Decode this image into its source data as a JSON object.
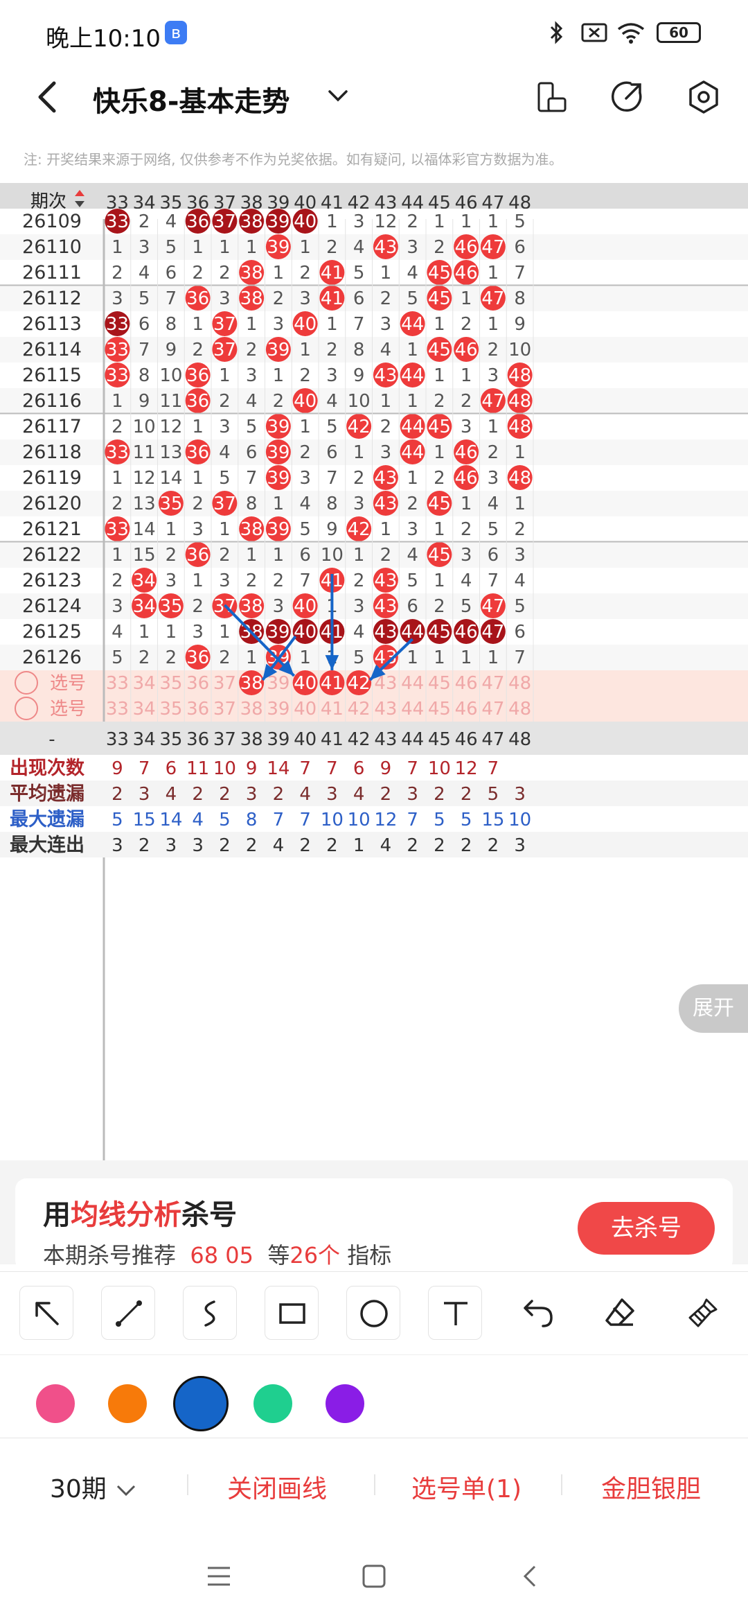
{
  "status_bar": {
    "time": "晚上10:10",
    "battery": "60"
  },
  "header": {
    "title": "快乐8-基本走势"
  },
  "note": "注: 开奖结果来源于网络, 仅供参考不作为兑奖依据。如有疑问, 以福体彩官方数据为准。",
  "table": {
    "period_header": "期次",
    "columns": [
      "33",
      "34",
      "35",
      "36",
      "37",
      "38",
      "39",
      "40",
      "41",
      "42",
      "43",
      "44",
      "45",
      "46",
      "47",
      "48"
    ],
    "rows": [
      {
        "period": "26109",
        "cells": [
          "33",
          "2",
          "4",
          "36",
          "37",
          "38",
          "39",
          "40",
          "1",
          "3",
          "12",
          "2",
          "1",
          "1",
          "1",
          "5"
        ]
      },
      {
        "period": "26110",
        "cells": [
          "1",
          "3",
          "5",
          "1",
          "1",
          "1",
          "39",
          "1",
          "2",
          "4",
          "43",
          "3",
          "2",
          "46",
          "47",
          "6"
        ]
      },
      {
        "period": "26111",
        "cells": [
          "2",
          "4",
          "6",
          "2",
          "2",
          "38",
          "1",
          "2",
          "41",
          "5",
          "1",
          "4",
          "45",
          "46",
          "1",
          "7"
        ]
      },
      {
        "period": "26112",
        "cells": [
          "3",
          "5",
          "7",
          "36",
          "3",
          "38",
          "2",
          "3",
          "41",
          "6",
          "2",
          "5",
          "45",
          "1",
          "47",
          "8"
        ]
      },
      {
        "period": "26113",
        "cells": [
          "33",
          "6",
          "8",
          "1",
          "37",
          "1",
          "3",
          "40",
          "1",
          "7",
          "3",
          "44",
          "1",
          "2",
          "1",
          "9"
        ]
      },
      {
        "period": "26114",
        "cells": [
          "33",
          "7",
          "9",
          "2",
          "37",
          "2",
          "39",
          "1",
          "2",
          "8",
          "4",
          "1",
          "45",
          "46",
          "2",
          "10"
        ]
      },
      {
        "period": "26115",
        "cells": [
          "33",
          "8",
          "10",
          "36",
          "1",
          "3",
          "1",
          "2",
          "3",
          "9",
          "43",
          "44",
          "1",
          "1",
          "3",
          "48"
        ]
      },
      {
        "period": "26116",
        "cells": [
          "1",
          "9",
          "11",
          "36",
          "2",
          "4",
          "2",
          "40",
          "4",
          "10",
          "1",
          "1",
          "2",
          "2",
          "47",
          "48"
        ]
      },
      {
        "period": "26117",
        "cells": [
          "2",
          "10",
          "12",
          "1",
          "3",
          "5",
          "39",
          "1",
          "5",
          "42",
          "2",
          "44",
          "45",
          "3",
          "1",
          "48"
        ]
      },
      {
        "period": "26118",
        "cells": [
          "33",
          "11",
          "13",
          "36",
          "4",
          "6",
          "39",
          "2",
          "6",
          "1",
          "3",
          "44",
          "1",
          "46",
          "2",
          "1"
        ]
      },
      {
        "period": "26119",
        "cells": [
          "1",
          "12",
          "14",
          "1",
          "5",
          "7",
          "39",
          "3",
          "7",
          "2",
          "43",
          "1",
          "2",
          "46",
          "3",
          "48"
        ]
      },
      {
        "period": "26120",
        "cells": [
          "2",
          "13",
          "35",
          "2",
          "37",
          "8",
          "1",
          "4",
          "8",
          "3",
          "43",
          "2",
          "45",
          "1",
          "4",
          "1"
        ]
      },
      {
        "period": "26121",
        "cells": [
          "33",
          "14",
          "1",
          "3",
          "1",
          "38",
          "39",
          "5",
          "9",
          "42",
          "1",
          "3",
          "1",
          "2",
          "5",
          "2"
        ]
      },
      {
        "period": "26122",
        "cells": [
          "1",
          "15",
          "2",
          "36",
          "2",
          "1",
          "1",
          "6",
          "10",
          "1",
          "2",
          "4",
          "45",
          "3",
          "6",
          "3"
        ]
      },
      {
        "period": "26123",
        "cells": [
          "2",
          "34",
          "3",
          "1",
          "3",
          "2",
          "2",
          "7",
          "41",
          "2",
          "43",
          "5",
          "1",
          "4",
          "7",
          "4"
        ]
      },
      {
        "period": "26124",
        "cells": [
          "3",
          "34",
          "35",
          "2",
          "37",
          "38",
          "3",
          "40",
          "1",
          "3",
          "43",
          "6",
          "2",
          "5",
          "47",
          "5"
        ]
      },
      {
        "period": "26125",
        "cells": [
          "4",
          "1",
          "1",
          "3",
          "1",
          "38",
          "39",
          "40",
          "41",
          "4",
          "43",
          "44",
          "45",
          "46",
          "47",
          "6"
        ]
      },
      {
        "period": "26126",
        "cells": [
          "5",
          "2",
          "2",
          "36",
          "2",
          "1",
          "39",
          "1",
          "1",
          "5",
          "43",
          "1",
          "1",
          "1",
          "1",
          "7"
        ]
      }
    ],
    "hot_rows": {
      "26109": [
        0,
        3,
        4,
        5,
        6,
        7
      ],
      "26113": [
        0
      ],
      "26125": [
        5,
        6,
        7,
        8,
        10,
        11,
        12,
        13,
        14
      ]
    },
    "select_rows": [
      {
        "label": "选号",
        "selected": [
          5,
          7,
          8,
          9
        ]
      },
      {
        "label": "选号",
        "selected": []
      }
    ],
    "footer_header": "-",
    "stats": [
      {
        "label": "出现次数",
        "values": [
          "9",
          "7",
          "6",
          "11",
          "10",
          "9",
          "14",
          "7",
          "7",
          "6",
          "9",
          "7",
          "10",
          "12",
          "7",
          ""
        ]
      },
      {
        "label": "平均遗漏",
        "values": [
          "2",
          "3",
          "4",
          "2",
          "2",
          "3",
          "2",
          "4",
          "3",
          "4",
          "2",
          "3",
          "2",
          "2",
          "5",
          "3"
        ]
      },
      {
        "label": "最大遗漏",
        "values": [
          "5",
          "15",
          "14",
          "4",
          "5",
          "8",
          "7",
          "7",
          "10",
          "10",
          "12",
          "7",
          "5",
          "5",
          "15",
          "10"
        ]
      },
      {
        "label": "最大连出",
        "values": [
          "3",
          "2",
          "3",
          "3",
          "2",
          "2",
          "4",
          "2",
          "2",
          "1",
          "4",
          "2",
          "2",
          "2",
          "2",
          "3"
        ]
      }
    ],
    "expand_label": "展开"
  },
  "promo": {
    "prefix": "用",
    "highlight": "均线分析",
    "suffix": "杀号",
    "line2_a": "本期杀号推荐",
    "numbers": "68 05",
    "line2_b": "等",
    "count": "26个",
    "line2_c": "指标",
    "button": "去杀号"
  },
  "tools": [
    "arrow-tool",
    "line-tool",
    "curve-tool",
    "rectangle-tool",
    "circle-tool",
    "text-tool",
    "undo-tool",
    "eraser-tool",
    "clear-tool"
  ],
  "colors": [
    "#f0508a",
    "#f77a0a",
    "#1565c8",
    "#1fcf8f",
    "#8a1de6"
  ],
  "selected_color": "#1565c8",
  "bottom_nav": {
    "period": "30期",
    "close_line": "关闭画线",
    "ticket": "选号单(1)",
    "golden": "金胆银胆"
  },
  "accent": "#e83c3c",
  "line_color": "#1565c8"
}
